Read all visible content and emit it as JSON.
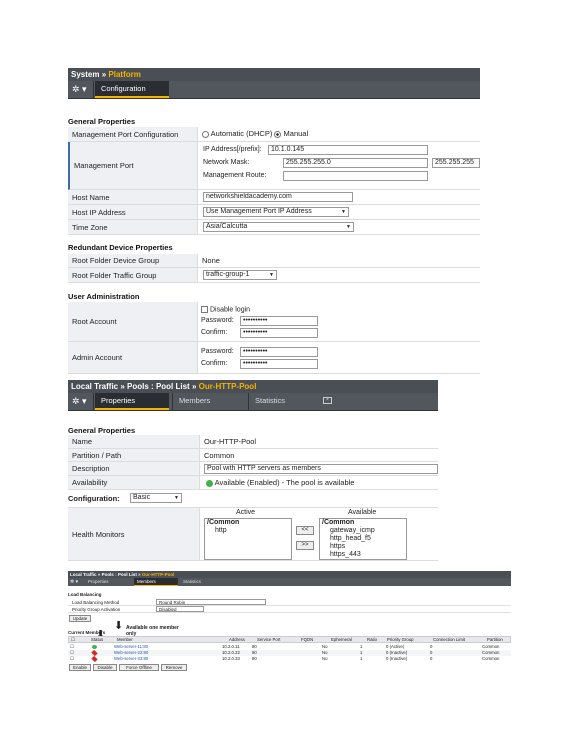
{
  "platform": {
    "breadcrumb": {
      "a": "System",
      "sep": "»",
      "b": "Platform"
    },
    "tabs": [
      {
        "label": "Configuration"
      }
    ],
    "general_title": "General Properties",
    "mgmt_port_config": {
      "label": "Management Port Configuration",
      "opt_auto": "Automatic (DHCP)",
      "opt_manual": "Manual"
    },
    "mgmt_port": {
      "label": "Management Port",
      "ip_label": "IP Address[/prefix]:",
      "ip_value": "10.1.0.145",
      "mask_label": "Network Mask:",
      "mask_value": "255.255.255.0",
      "mask_extra": "255.255.255",
      "route_label": "Management Route:",
      "route_value": ""
    },
    "host_name": {
      "label": "Host Name",
      "value": "networkshieldacademy.com"
    },
    "host_ip": {
      "label": "Host IP Address",
      "value": "Use Management Port IP Address"
    },
    "time_zone": {
      "label": "Time Zone",
      "value": "Asia/Calcutta"
    },
    "redundant_title": "Redundant Device Properties",
    "root_folder_group": {
      "label": "Root Folder Device Group",
      "value": "None"
    },
    "root_folder_traffic": {
      "label": "Root Folder Traffic Group",
      "value": "traffic-group-1"
    },
    "user_admin_title": "User Administration",
    "root_account": {
      "label": "Root Account",
      "disable_login": "Disable login",
      "password_label": "Password:",
      "password_value": "••••••••••",
      "confirm_label": "Confirm:",
      "confirm_value": "••••••••••"
    },
    "admin_account": {
      "label": "Admin Account",
      "password_label": "Password:",
      "password_value": "••••••••••",
      "confirm_label": "Confirm:",
      "confirm_value": "••••••••••"
    }
  },
  "pool": {
    "breadcrumb": {
      "a": "Local Traffic",
      "sep1": "»",
      "b": "Pools : Pool List",
      "sep2": "»",
      "c": "Our-HTTP-Pool"
    },
    "tabs": [
      {
        "label": "Properties"
      },
      {
        "label": "Members"
      },
      {
        "label": "Statistics"
      }
    ],
    "general_title": "General Properties",
    "name": {
      "label": "Name",
      "value": "Our-HTTP-Pool"
    },
    "partition": {
      "label": "Partition / Path",
      "value": "Common"
    },
    "description": {
      "label": "Description",
      "value": "Pool with HTTP servers as members"
    },
    "availability": {
      "label": "Availability",
      "value": "Available (Enabled) - The pool is available"
    },
    "config_label": "Configuration:",
    "config_mode": "Basic",
    "health": {
      "label": "Health Monitors",
      "active_title": "Active",
      "available_title": "Available",
      "active_items": [
        "/Common",
        "http"
      ],
      "available_items": [
        "/Common",
        "gateway_icmp",
        "http_head_f5",
        "https",
        "https_443"
      ],
      "btn_add": "<<",
      "btn_remove": ">>"
    }
  },
  "members": {
    "breadcrumb": {
      "a": "Local Traffic",
      "sep1": "»",
      "b": "Pools : Pool List",
      "sep2": "»",
      "c": "Our-HTTP-Pool"
    },
    "tabs": [
      {
        "label": "Properties"
      },
      {
        "label": "Members"
      },
      {
        "label": "Statistics"
      }
    ],
    "lb_title": "Load Balancing",
    "lb_method": {
      "label": "Load Balancing Method",
      "value": "Round Robin"
    },
    "priority": {
      "label": "Priority Group Activation",
      "value": "Disabled"
    },
    "update_btn": "Update",
    "annotation": "Available one member only",
    "current_members": "Current Members",
    "columns": [
      "Status",
      "Member",
      "Address",
      "Service Port",
      "FQDN",
      "Ephemeral",
      "Ratio",
      "Priority Group",
      "Connection Limit",
      "Partition"
    ],
    "rows": [
      {
        "status": "green",
        "member": "Web-server-11:80",
        "address": "10.2.0.11",
        "port": "80",
        "ephemeral": "No",
        "ratio": "1",
        "priority": "0 (Active)",
        "conn": "0",
        "partition": "Common"
      },
      {
        "status": "red",
        "member": "Web-server-22:80",
        "address": "10.2.0.22",
        "port": "80",
        "ephemeral": "No",
        "ratio": "1",
        "priority": "0 (Inactive)",
        "conn": "0",
        "partition": "Common"
      },
      {
        "status": "red",
        "member": "Web-server-33:80",
        "address": "10.2.0.33",
        "port": "80",
        "ephemeral": "No",
        "ratio": "1",
        "priority": "0 (Inactive)",
        "conn": "0",
        "partition": "Common"
      }
    ],
    "buttons": [
      "Enable",
      "Disable",
      "Force Offline",
      "Remove"
    ]
  },
  "colors": {
    "accent": "#f5b400",
    "header": "#4a4e55",
    "link": "#2255aa"
  }
}
